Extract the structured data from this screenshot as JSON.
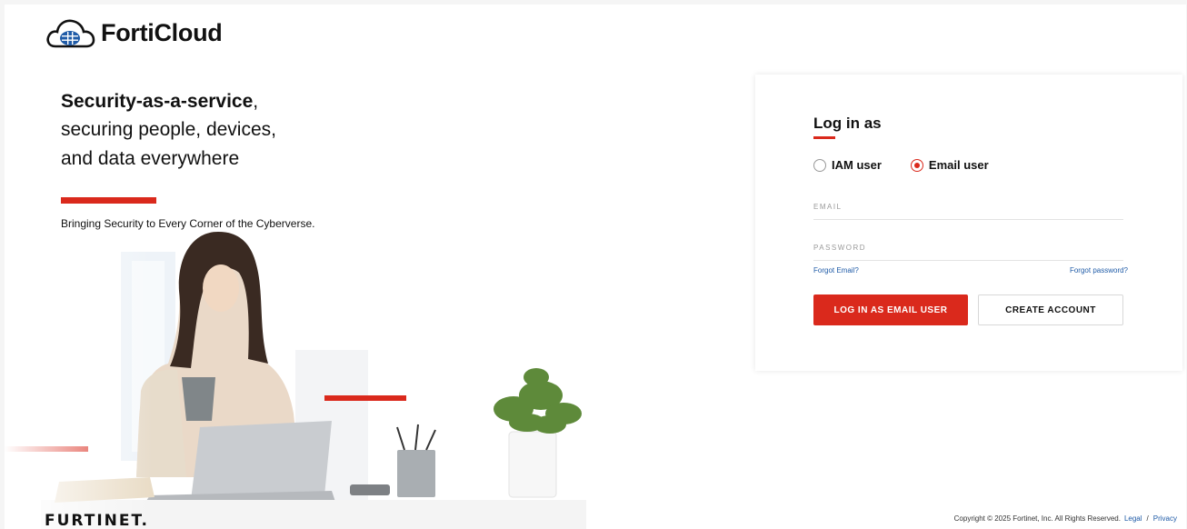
{
  "header": {
    "logo_text": "FortiCloud"
  },
  "hero": {
    "bold_text": "Security-as-a-service",
    "comma": ",",
    "line2": "securing people, devices,",
    "line3": "and data everywhere",
    "tagline": "Bringing Security to Every Corner of the Cyberverse."
  },
  "login": {
    "title": "Log in as",
    "radio_options": [
      {
        "label": "IAM user",
        "checked": false
      },
      {
        "label": "Email user",
        "checked": true
      }
    ],
    "email_placeholder": "EMAIL",
    "password_placeholder": "PASSWORD",
    "forgot_email": "Forgot Email?",
    "forgot_password": "Forgot password?",
    "login_button": "LOG IN AS EMAIL USER",
    "create_button": "CREATE ACCOUNT"
  },
  "footer": {
    "brand": "FURTINET.",
    "copyright": "Copyright © 2025 Fortinet, Inc. All Rights Reserved.",
    "legal": "Legal",
    "separator": "/",
    "privacy": "Privacy"
  },
  "colors": {
    "accent": "#da291c",
    "link": "#1f5ba7"
  }
}
